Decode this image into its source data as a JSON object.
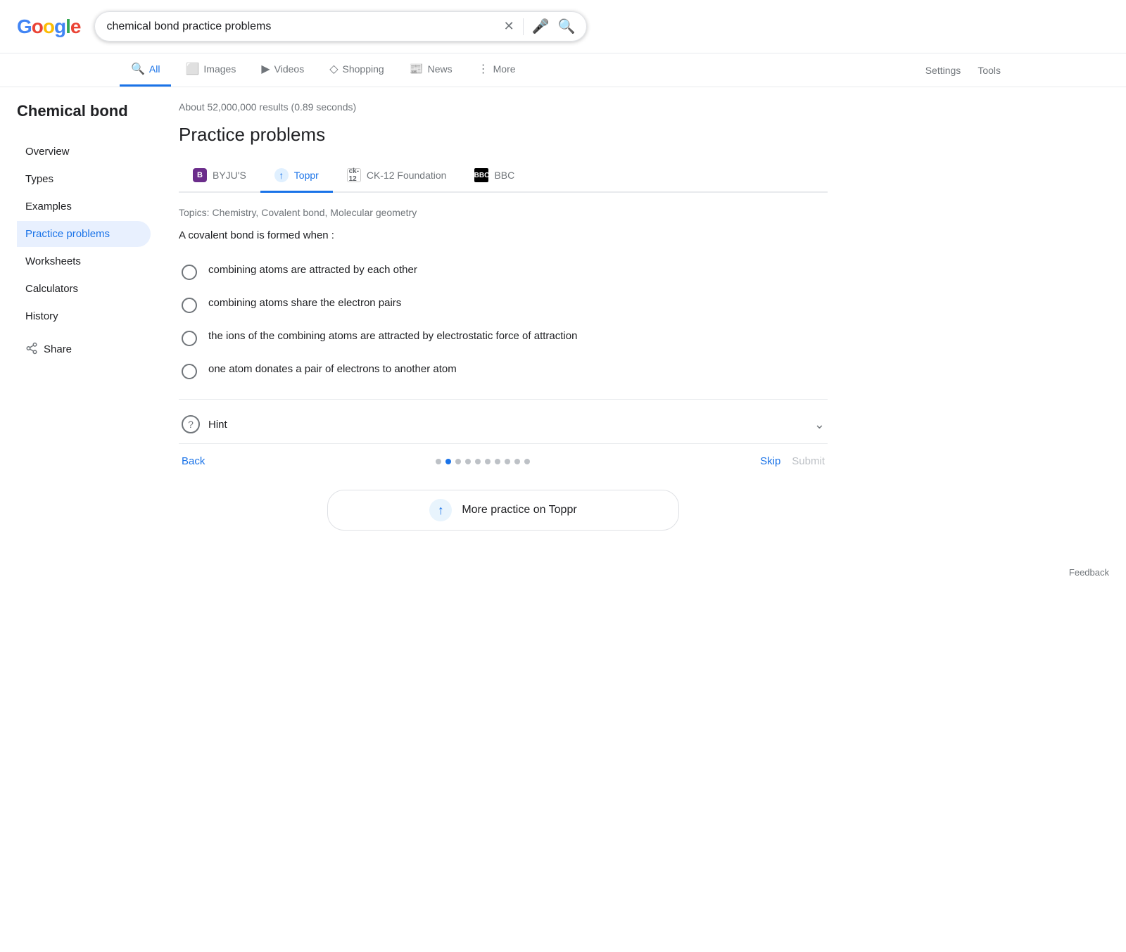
{
  "header": {
    "search_query": "chemical bond practice problems",
    "clear_label": "×",
    "search_label": "🔍"
  },
  "nav": {
    "tabs": [
      {
        "id": "all",
        "label": "All",
        "icon": "🔍",
        "active": true
      },
      {
        "id": "images",
        "label": "Images",
        "icon": "🖼"
      },
      {
        "id": "videos",
        "label": "Videos",
        "icon": "▶"
      },
      {
        "id": "shopping",
        "label": "Shopping",
        "icon": "◇"
      },
      {
        "id": "news",
        "label": "News",
        "icon": "📰"
      },
      {
        "id": "more",
        "label": "More",
        "icon": "⋮"
      }
    ],
    "settings": "Settings",
    "tools": "Tools"
  },
  "sidebar": {
    "title": "Chemical bond",
    "items": [
      {
        "id": "overview",
        "label": "Overview",
        "active": false
      },
      {
        "id": "types",
        "label": "Types",
        "active": false
      },
      {
        "id": "examples",
        "label": "Examples",
        "active": false
      },
      {
        "id": "practice",
        "label": "Practice problems",
        "active": true
      },
      {
        "id": "worksheets",
        "label": "Worksheets",
        "active": false
      },
      {
        "id": "calculators",
        "label": "Calculators",
        "active": false
      },
      {
        "id": "history",
        "label": "History",
        "active": false
      }
    ],
    "share_label": "Share"
  },
  "results": {
    "count": "About 52,000,000 results (0.89 seconds)",
    "section_title": "Practice problems",
    "source_tabs": [
      {
        "id": "byjus",
        "label": "BYJU'S",
        "active": false
      },
      {
        "id": "toppr",
        "label": "Toppr",
        "active": true
      },
      {
        "id": "ck12",
        "label": "CK-12 Foundation",
        "active": false
      },
      {
        "id": "bbc",
        "label": "BBC",
        "active": false
      }
    ],
    "topics": "Topics: Chemistry, Covalent bond, Molecular geometry",
    "question": "A covalent bond is formed when :",
    "options": [
      {
        "id": "opt1",
        "text": "combining atoms are attracted by each other"
      },
      {
        "id": "opt2",
        "text": "combining atoms share the electron pairs"
      },
      {
        "id": "opt3",
        "text": "the ions of the combining atoms are attracted by electrostatic force of attraction"
      },
      {
        "id": "opt4",
        "text": "one atom donates a pair of electrons to another atom"
      }
    ],
    "hint_label": "Hint",
    "back_label": "Back",
    "skip_label": "Skip",
    "submit_label": "Submit",
    "pagination": {
      "total": 10,
      "active_index": 1
    },
    "more_practice_label": "More practice on Toppr",
    "feedback_label": "Feedback"
  }
}
